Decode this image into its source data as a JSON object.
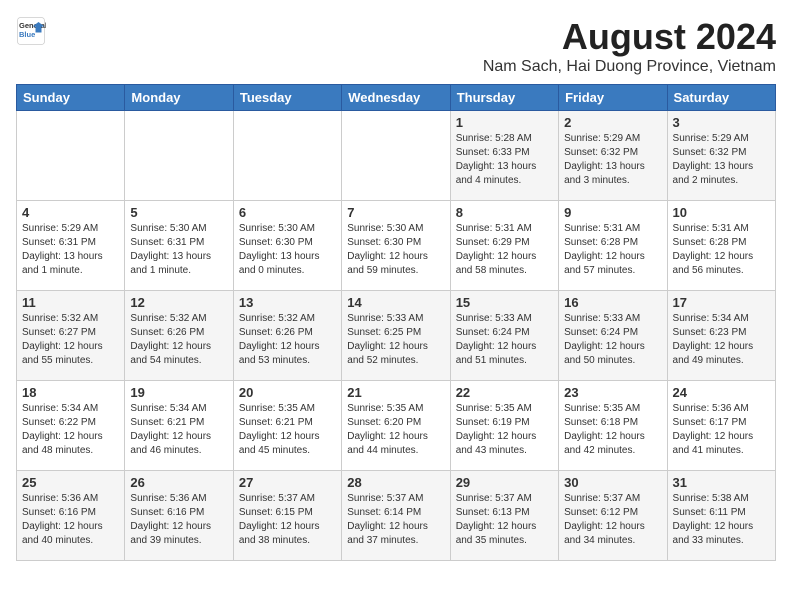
{
  "logo": {
    "general": "General",
    "blue": "Blue"
  },
  "title": "August 2024",
  "subtitle": "Nam Sach, Hai Duong Province, Vietnam",
  "headers": [
    "Sunday",
    "Monday",
    "Tuesday",
    "Wednesday",
    "Thursday",
    "Friday",
    "Saturday"
  ],
  "weeks": [
    [
      {
        "day": "",
        "info": ""
      },
      {
        "day": "",
        "info": ""
      },
      {
        "day": "",
        "info": ""
      },
      {
        "day": "",
        "info": ""
      },
      {
        "day": "1",
        "info": "Sunrise: 5:28 AM\nSunset: 6:33 PM\nDaylight: 13 hours\nand 4 minutes."
      },
      {
        "day": "2",
        "info": "Sunrise: 5:29 AM\nSunset: 6:32 PM\nDaylight: 13 hours\nand 3 minutes."
      },
      {
        "day": "3",
        "info": "Sunrise: 5:29 AM\nSunset: 6:32 PM\nDaylight: 13 hours\nand 2 minutes."
      }
    ],
    [
      {
        "day": "4",
        "info": "Sunrise: 5:29 AM\nSunset: 6:31 PM\nDaylight: 13 hours\nand 1 minute."
      },
      {
        "day": "5",
        "info": "Sunrise: 5:30 AM\nSunset: 6:31 PM\nDaylight: 13 hours\nand 1 minute."
      },
      {
        "day": "6",
        "info": "Sunrise: 5:30 AM\nSunset: 6:30 PM\nDaylight: 13 hours\nand 0 minutes."
      },
      {
        "day": "7",
        "info": "Sunrise: 5:30 AM\nSunset: 6:30 PM\nDaylight: 12 hours\nand 59 minutes."
      },
      {
        "day": "8",
        "info": "Sunrise: 5:31 AM\nSunset: 6:29 PM\nDaylight: 12 hours\nand 58 minutes."
      },
      {
        "day": "9",
        "info": "Sunrise: 5:31 AM\nSunset: 6:28 PM\nDaylight: 12 hours\nand 57 minutes."
      },
      {
        "day": "10",
        "info": "Sunrise: 5:31 AM\nSunset: 6:28 PM\nDaylight: 12 hours\nand 56 minutes."
      }
    ],
    [
      {
        "day": "11",
        "info": "Sunrise: 5:32 AM\nSunset: 6:27 PM\nDaylight: 12 hours\nand 55 minutes."
      },
      {
        "day": "12",
        "info": "Sunrise: 5:32 AM\nSunset: 6:26 PM\nDaylight: 12 hours\nand 54 minutes."
      },
      {
        "day": "13",
        "info": "Sunrise: 5:32 AM\nSunset: 6:26 PM\nDaylight: 12 hours\nand 53 minutes."
      },
      {
        "day": "14",
        "info": "Sunrise: 5:33 AM\nSunset: 6:25 PM\nDaylight: 12 hours\nand 52 minutes."
      },
      {
        "day": "15",
        "info": "Sunrise: 5:33 AM\nSunset: 6:24 PM\nDaylight: 12 hours\nand 51 minutes."
      },
      {
        "day": "16",
        "info": "Sunrise: 5:33 AM\nSunset: 6:24 PM\nDaylight: 12 hours\nand 50 minutes."
      },
      {
        "day": "17",
        "info": "Sunrise: 5:34 AM\nSunset: 6:23 PM\nDaylight: 12 hours\nand 49 minutes."
      }
    ],
    [
      {
        "day": "18",
        "info": "Sunrise: 5:34 AM\nSunset: 6:22 PM\nDaylight: 12 hours\nand 48 minutes."
      },
      {
        "day": "19",
        "info": "Sunrise: 5:34 AM\nSunset: 6:21 PM\nDaylight: 12 hours\nand 46 minutes."
      },
      {
        "day": "20",
        "info": "Sunrise: 5:35 AM\nSunset: 6:21 PM\nDaylight: 12 hours\nand 45 minutes."
      },
      {
        "day": "21",
        "info": "Sunrise: 5:35 AM\nSunset: 6:20 PM\nDaylight: 12 hours\nand 44 minutes."
      },
      {
        "day": "22",
        "info": "Sunrise: 5:35 AM\nSunset: 6:19 PM\nDaylight: 12 hours\nand 43 minutes."
      },
      {
        "day": "23",
        "info": "Sunrise: 5:35 AM\nSunset: 6:18 PM\nDaylight: 12 hours\nand 42 minutes."
      },
      {
        "day": "24",
        "info": "Sunrise: 5:36 AM\nSunset: 6:17 PM\nDaylight: 12 hours\nand 41 minutes."
      }
    ],
    [
      {
        "day": "25",
        "info": "Sunrise: 5:36 AM\nSunset: 6:16 PM\nDaylight: 12 hours\nand 40 minutes."
      },
      {
        "day": "26",
        "info": "Sunrise: 5:36 AM\nSunset: 6:16 PM\nDaylight: 12 hours\nand 39 minutes."
      },
      {
        "day": "27",
        "info": "Sunrise: 5:37 AM\nSunset: 6:15 PM\nDaylight: 12 hours\nand 38 minutes."
      },
      {
        "day": "28",
        "info": "Sunrise: 5:37 AM\nSunset: 6:14 PM\nDaylight: 12 hours\nand 37 minutes."
      },
      {
        "day": "29",
        "info": "Sunrise: 5:37 AM\nSunset: 6:13 PM\nDaylight: 12 hours\nand 35 minutes."
      },
      {
        "day": "30",
        "info": "Sunrise: 5:37 AM\nSunset: 6:12 PM\nDaylight: 12 hours\nand 34 minutes."
      },
      {
        "day": "31",
        "info": "Sunrise: 5:38 AM\nSunset: 6:11 PM\nDaylight: 12 hours\nand 33 minutes."
      }
    ]
  ]
}
